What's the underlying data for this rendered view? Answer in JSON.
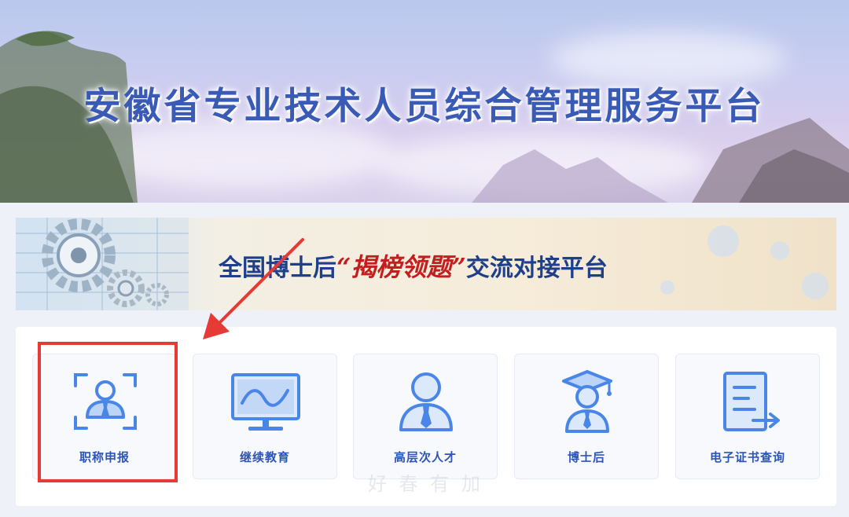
{
  "header": {
    "title": "安徽省专业技术人员综合管理服务平台"
  },
  "banner": {
    "prefix": "全国博士后",
    "quote_open": "“",
    "highlight": "揭榜领题",
    "quote_close": "”",
    "suffix": "交流对接平台"
  },
  "cards": [
    {
      "label": "职称申报",
      "icon": "person-scan-icon"
    },
    {
      "label": "继续教育",
      "icon": "monitor-wave-icon"
    },
    {
      "label": "高层次人才",
      "icon": "person-tie-icon"
    },
    {
      "label": "博士后",
      "icon": "graduate-cap-icon"
    },
    {
      "label": "电子证书查询",
      "icon": "document-arrow-icon"
    }
  ],
  "watermark": "好 春 有 加",
  "colors": {
    "accent": "#2d54b7",
    "icon_blue": "#4a86e8",
    "highlight": "#e53a35",
    "banner_red": "#c41f1f"
  }
}
